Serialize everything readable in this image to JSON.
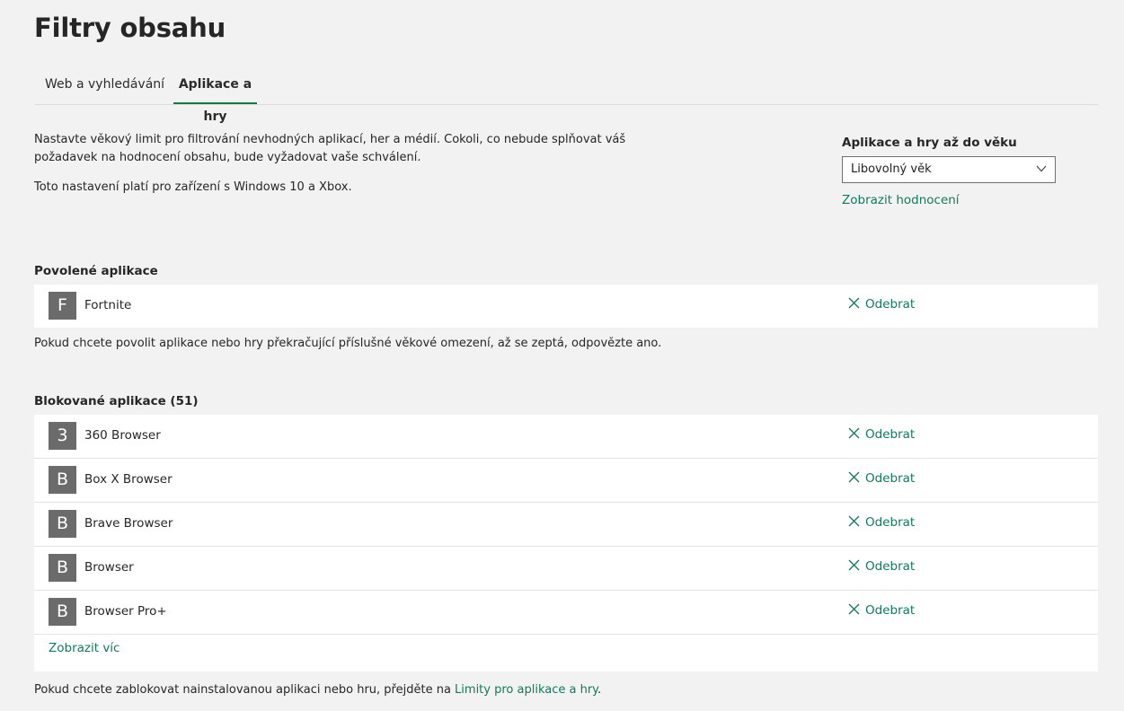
{
  "page": {
    "title": "Filtry obsahu"
  },
  "tabs": [
    {
      "label": "Web a vyhledávání",
      "active": false
    },
    {
      "label": "Aplikace a hry",
      "active": true
    }
  ],
  "description": {
    "line1": "Nastavte věkový limit pro filtrování nevhodných aplikací, her a médií. Cokoli, co nebude splňovat váš požadavek na hodnocení obsahu, bude vyžadovat vaše schválení.",
    "line2": "Toto nastavení platí pro zařízení s Windows 10 a Xbox."
  },
  "age_limit": {
    "label": "Aplikace a hry až do věku",
    "selected": "Libovolný věk",
    "rating_link": "Zobrazit hodnocení"
  },
  "allowed": {
    "title": "Povolené aplikace",
    "items": [
      {
        "letter": "F",
        "name": "Fortnite",
        "action": "Odebrat"
      }
    ],
    "note": "Pokud chcete povolit aplikace nebo hry překračující příslušné věkové omezení, až se zeptá, odpovězte ano."
  },
  "blocked": {
    "title": "Blokované aplikace (51)",
    "items": [
      {
        "letter": "3",
        "name": "360 Browser",
        "action": "Odebrat"
      },
      {
        "letter": "B",
        "name": "Box X Browser",
        "action": "Odebrat"
      },
      {
        "letter": "B",
        "name": "Brave Browser",
        "action": "Odebrat"
      },
      {
        "letter": "B",
        "name": "Browser",
        "action": "Odebrat"
      },
      {
        "letter": "B",
        "name": "Browser Pro+",
        "action": "Odebrat"
      }
    ],
    "show_more": "Zobrazit víc",
    "note_prefix": "Pokud chcete zablokovat nainstalovanou aplikaci nebo hru, přejděte na ",
    "note_link": "Limity pro aplikace a hry",
    "note_suffix": "."
  },
  "colors": {
    "accent": "#107c41",
    "link": "#0f7b5a",
    "background": "#f2f2f2",
    "icon_tile": "#6b6b6b"
  }
}
